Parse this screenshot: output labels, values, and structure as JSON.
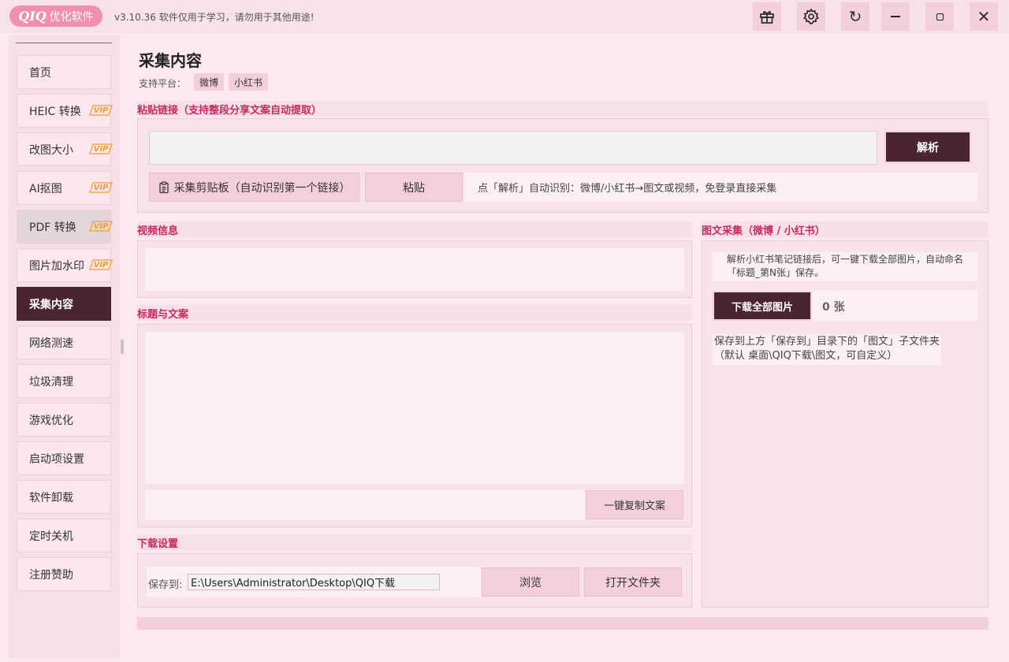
{
  "titlebar": {
    "logo_mark": "QIQ",
    "logo_text": "优化软件",
    "version": "v3.10.36 软件仅用于学习，请勿用于其他用途!",
    "buttons": [
      "gift-icon",
      "gear-icon",
      "refresh-icon",
      "minimize-icon",
      "maximize-icon",
      "close-icon"
    ]
  },
  "sidebar": {
    "items": [
      {
        "label": "首页",
        "vip": false
      },
      {
        "label": "HEIC 转换",
        "vip": true
      },
      {
        "label": "改图大小",
        "vip": true
      },
      {
        "label": "AI抠图",
        "vip": true
      },
      {
        "label": "PDF 转换",
        "vip": true
      },
      {
        "label": "图片加水印",
        "vip": true
      },
      {
        "label": "采集内容",
        "vip": false
      },
      {
        "label": "网络测速",
        "vip": false
      },
      {
        "label": "垃圾清理",
        "vip": false
      },
      {
        "label": "游戏优化",
        "vip": false
      },
      {
        "label": "启动项设置",
        "vip": false
      },
      {
        "label": "软件卸载",
        "vip": false
      },
      {
        "label": "定时关机",
        "vip": false
      },
      {
        "label": "注册赞助",
        "vip": false
      }
    ],
    "vip_label": "VIP",
    "active_index": 6,
    "hover_index": 4
  },
  "main": {
    "title": "采集内容",
    "platforms_label": "支持平台：",
    "platforms": [
      "微博",
      "小红书"
    ],
    "paste_section": {
      "heading": "粘贴链接（支持整段分享文案自动提取）",
      "input_value": "",
      "parse_button": "解析",
      "clipboard_button": "采集剪贴板（自动识别第一个链接）",
      "paste_button": "粘贴",
      "hint": "点「解析」自动识别：微博/小红书→图文或视频，免登录直接采集"
    },
    "video_section": {
      "heading": "视频信息"
    },
    "text_section": {
      "heading": "标题与文案",
      "copy_button": "一键复制文案"
    },
    "image_section": {
      "heading": "图文采集（微博 / 小红书）",
      "note": "解析小红书笔记链接后，可一键下载全部图片，自动命名「标题_第N张」保存。",
      "download_button": "下载全部图片",
      "count": "0 张",
      "save_note": "保存到上方「保存到」目录下的「图文」子文件夹（默认 桌面\\QIQ下载\\图文，可自定义）"
    },
    "download_section": {
      "heading": "下载设置",
      "save_label": "保存到:",
      "save_path": "E:\\Users\\Administrator\\Desktop\\QIQ下载",
      "browse_button": "浏览",
      "open_folder_button": "打开文件夹"
    }
  },
  "colors": {
    "accent_dark": "#4a2430",
    "accent_pink": "#f08fb2",
    "heading_red": "#c72a62",
    "vip_orange": "#f0a02a"
  }
}
